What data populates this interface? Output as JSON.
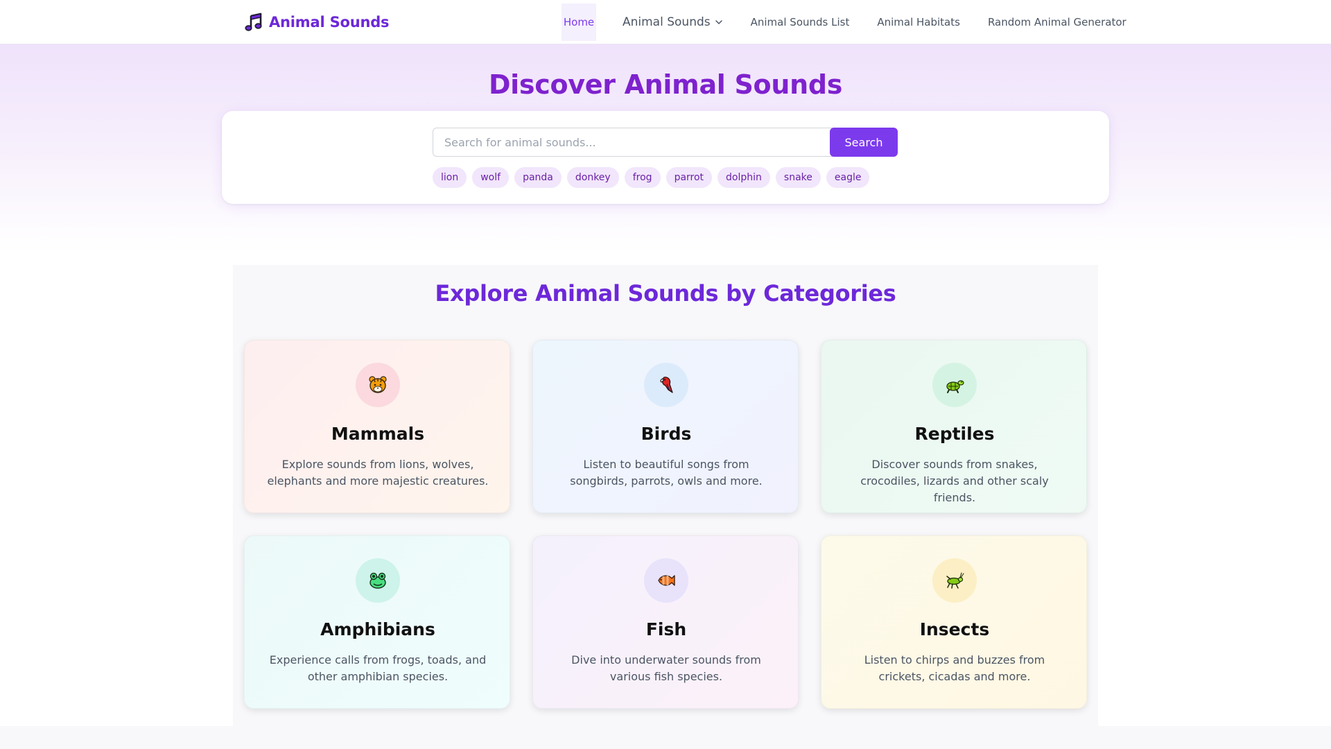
{
  "brand": {
    "name": "Animal Sounds",
    "icon": "music-note-icon",
    "color": "#6d28d9"
  },
  "nav": {
    "items": [
      {
        "label": "Home",
        "active": true
      },
      {
        "label": "Animal Sounds",
        "dropdown": true
      },
      {
        "label": "Animal Sounds List"
      },
      {
        "label": "Animal Habitats"
      },
      {
        "label": "Random Animal Generator"
      }
    ]
  },
  "hero": {
    "title": "Discover Animal Sounds",
    "search": {
      "placeholder": "Search for animal sounds...",
      "value": "",
      "button_label": "Search"
    },
    "tags": [
      "lion",
      "wolf",
      "panda",
      "donkey",
      "frog",
      "parrot",
      "dolphin",
      "snake",
      "eagle"
    ]
  },
  "categories": {
    "title": "Explore Animal Sounds by Categories",
    "items": [
      {
        "title": "Mammals",
        "description": "Explore sounds from lions, wolves, elephants and more majestic creatures.",
        "icon": "tiger-icon"
      },
      {
        "title": "Birds",
        "description": "Listen to beautiful songs from songbirds, parrots, owls and more.",
        "icon": "parrot-icon"
      },
      {
        "title": "Reptiles",
        "description": "Discover sounds from snakes, crocodiles, lizards and other scaly friends.",
        "icon": "turtle-icon"
      },
      {
        "title": "Amphibians",
        "description": "Experience calls from frogs, toads, and other amphibian species.",
        "icon": "frog-icon"
      },
      {
        "title": "Fish",
        "description": "Dive into underwater sounds from various fish species.",
        "icon": "fish-icon"
      },
      {
        "title": "Insects",
        "description": "Listen to chirps and buzzes from crickets, cicadas and more.",
        "icon": "cricket-icon"
      }
    ]
  },
  "colors": {
    "accent": "#7c3aed",
    "hero_title": "#7e22ce",
    "section_title": "#6d28d9",
    "tag_bg": "#f1e6fb"
  }
}
